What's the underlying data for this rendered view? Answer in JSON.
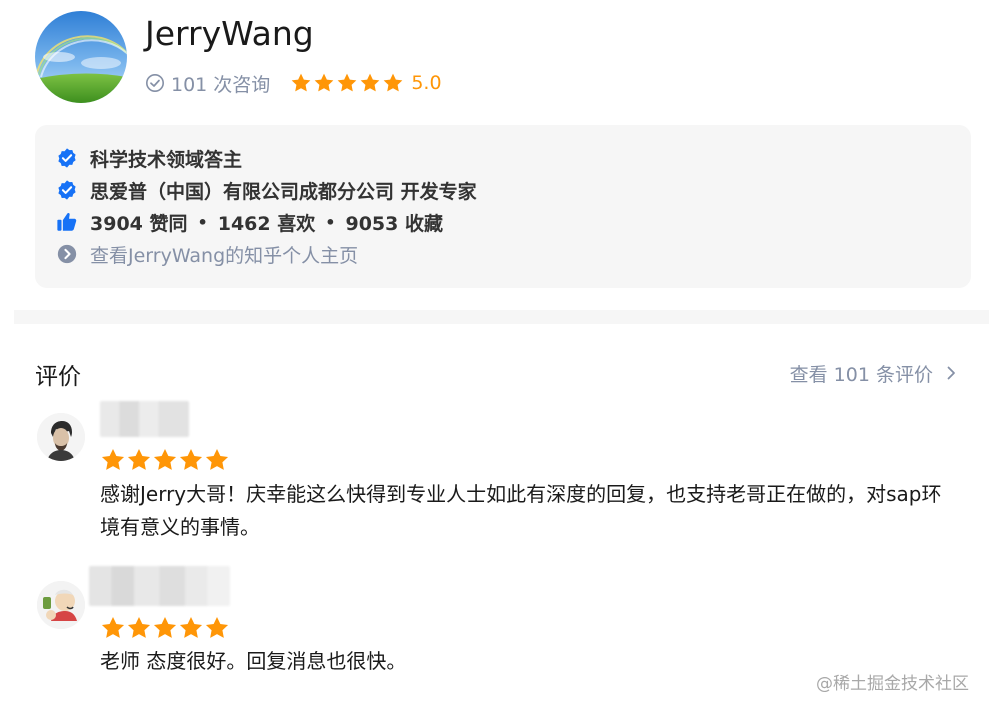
{
  "profile": {
    "name": "JerryWang",
    "consult_count": "101 次咨询",
    "rating": "5.0",
    "star_count": 5
  },
  "info": {
    "domain": "科学技术领域答主",
    "company": "思爱普（中国）有限公司成都分公司 开发专家",
    "likes": "3904 赞同",
    "favs": "1462 喜欢",
    "collects": "9053 收藏",
    "separator": "•",
    "homepage_link": "查看JerryWang的知乎个人主页"
  },
  "reviews": {
    "title": "评价",
    "more_link": "查看 101 条评价",
    "items": [
      {
        "text": "感谢Jerry大哥！庆幸能这么快得到专业人士如此有深度的回复，也支持老哥正在做的，对sap环境有意义的事情。",
        "stars": 5
      },
      {
        "text": "老师 态度很好。回复消息也很快。",
        "stars": 5
      }
    ]
  },
  "watermark": "@稀土掘金技术社区",
  "colors": {
    "accent_star": "#ff9607",
    "verified_blue": "#1772f6",
    "muted_text": "#8590a6",
    "card_bg": "#f6f6f6"
  },
  "icons": {
    "verified": "verified-badge-icon",
    "thumb": "thumbs-up-icon",
    "arrow": "chevron-right-circle-icon",
    "check": "check-circle-icon",
    "star": "star-icon"
  }
}
